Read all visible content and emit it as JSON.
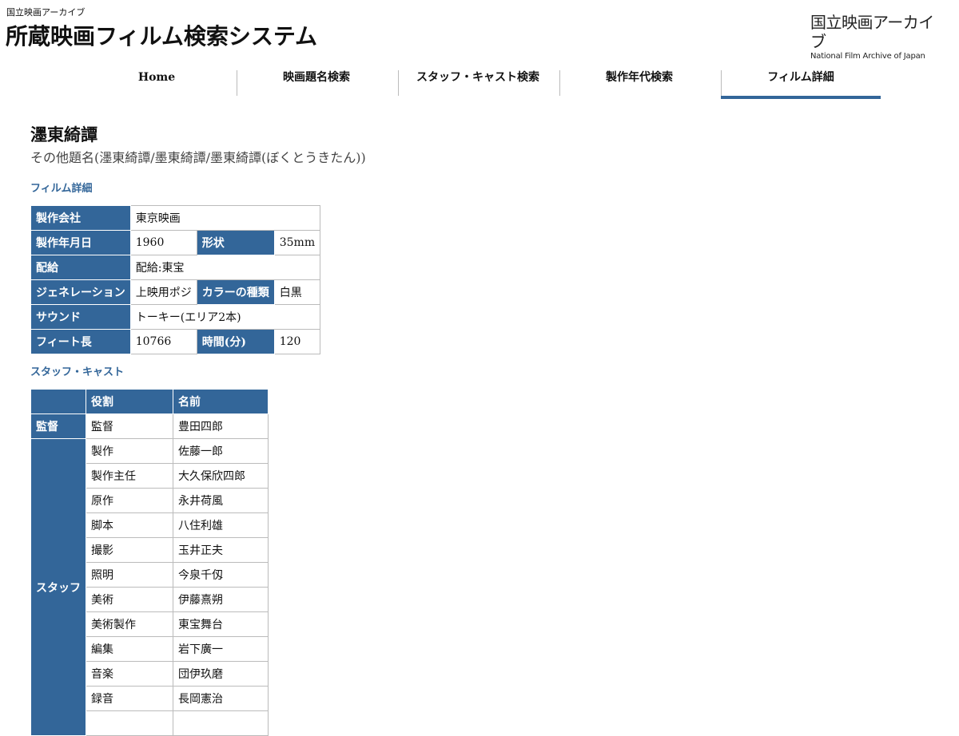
{
  "header": {
    "org_small": "国立映画アーカイブ",
    "site_title": "所蔵映画フィルム検索システム",
    "logo_jp": "国立映画アーカイブ",
    "logo_en": "National Film Archive of Japan"
  },
  "nav": [
    {
      "label": "Home"
    },
    {
      "label": "映画題名検索"
    },
    {
      "label": "スタッフ・キャスト検索"
    },
    {
      "label": "製作年代検索"
    },
    {
      "label": "フィルム詳細"
    }
  ],
  "film": {
    "title": "濹東綺譚",
    "alt_title": "その他題名(濹東綺譚/墨東綺譚/墨東綺譚(ぼくとうきたん))"
  },
  "details_heading": "フィルム詳細",
  "details": {
    "company_label": "製作会社",
    "company_value": "東京映画",
    "date_label": "製作年月日",
    "date_value": "1960",
    "format_label": "形状",
    "format_value": "35mm",
    "distribution_label": "配給",
    "distribution_value": "配給:東宝",
    "generation_label": "ジェネレーション",
    "generation_value": "上映用ポジ",
    "color_label": "カラーの種類",
    "color_value": "白黒",
    "sound_label": "サウンド",
    "sound_value": "トーキー(エリア2本)",
    "feet_label": "フィート長",
    "feet_value": "10766",
    "time_label": "時間(分)",
    "time_value": "120"
  },
  "staff_heading": "スタッフ・キャスト",
  "staff_table": {
    "col_role": "役割",
    "col_name": "名前",
    "director_group": "監督",
    "staff_group": "スタッフ",
    "director_rows": [
      {
        "role": "監督",
        "name": "豊田四郎"
      }
    ],
    "staff_rows": [
      {
        "role": "製作",
        "name": "佐藤一郎"
      },
      {
        "role": "製作主任",
        "name": "大久保欣四郎"
      },
      {
        "role": "原作",
        "name": "永井荷風"
      },
      {
        "role": "脚本",
        "name": "八住利雄"
      },
      {
        "role": "撮影",
        "name": "玉井正夫"
      },
      {
        "role": "照明",
        "name": "今泉千仭"
      },
      {
        "role": "美術",
        "name": "伊藤熹朔"
      },
      {
        "role": "美術製作",
        "name": "東宝舞台"
      },
      {
        "role": "編集",
        "name": "岩下廣一"
      },
      {
        "role": "音楽",
        "name": "団伊玖磨"
      },
      {
        "role": "録音",
        "name": "長岡憲治"
      }
    ]
  },
  "colors": {
    "accent": "#336699",
    "border": "#bbbbbb"
  }
}
